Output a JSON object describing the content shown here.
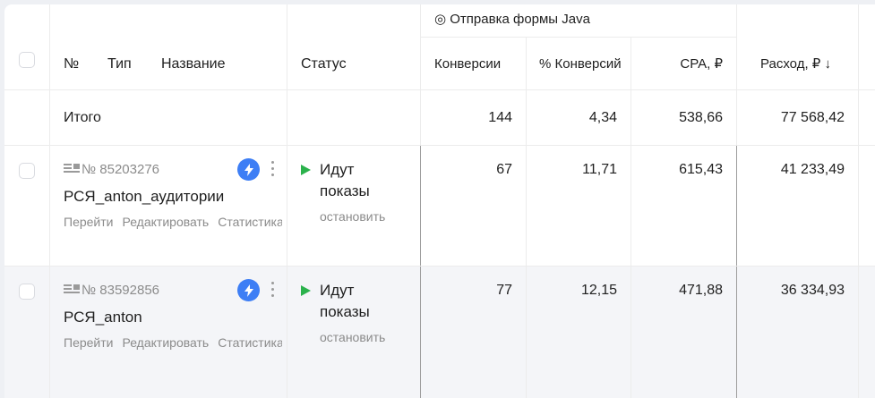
{
  "header": {
    "col_number": "№",
    "col_type": "Тип",
    "col_name": "Название",
    "col_status": "Статус",
    "goal_group": "◎ Отправка формы Java",
    "col_conversions": "Конверсии",
    "col_conv_pct": "% Конверсий",
    "col_cpa": "CPA, ₽",
    "col_spend": "Расход, ₽ ↓"
  },
  "totals": {
    "label": "Итого",
    "conversions": "144",
    "conv_pct": "4,34",
    "cpa": "538,66",
    "spend": "77 568,42"
  },
  "rows": [
    {
      "id": "№ 85203276",
      "name": "РСЯ_anton_аудитории",
      "link_go": "Перейти",
      "link_edit": "Редактировать",
      "link_stats": "Статистика",
      "status_line1": "Идут",
      "status_line2": "показы",
      "status_action": "остановить",
      "conversions": "67",
      "conv_pct": "11,71",
      "cpa": "615,43",
      "spend": "41 233,49"
    },
    {
      "id": "№ 83592856",
      "name": "РСЯ_anton",
      "link_go": "Перейти",
      "link_edit": "Редактировать",
      "link_stats": "Статистика",
      "status_line1": "Идут",
      "status_line2": "показы",
      "status_action": "остановить",
      "conversions": "77",
      "conv_pct": "12,15",
      "cpa": "471,88",
      "spend": "36 334,93"
    }
  ],
  "colors": {
    "accent": "#3d7ef5",
    "play": "#2bb24c",
    "row_highlight": "#f4f5f8"
  }
}
